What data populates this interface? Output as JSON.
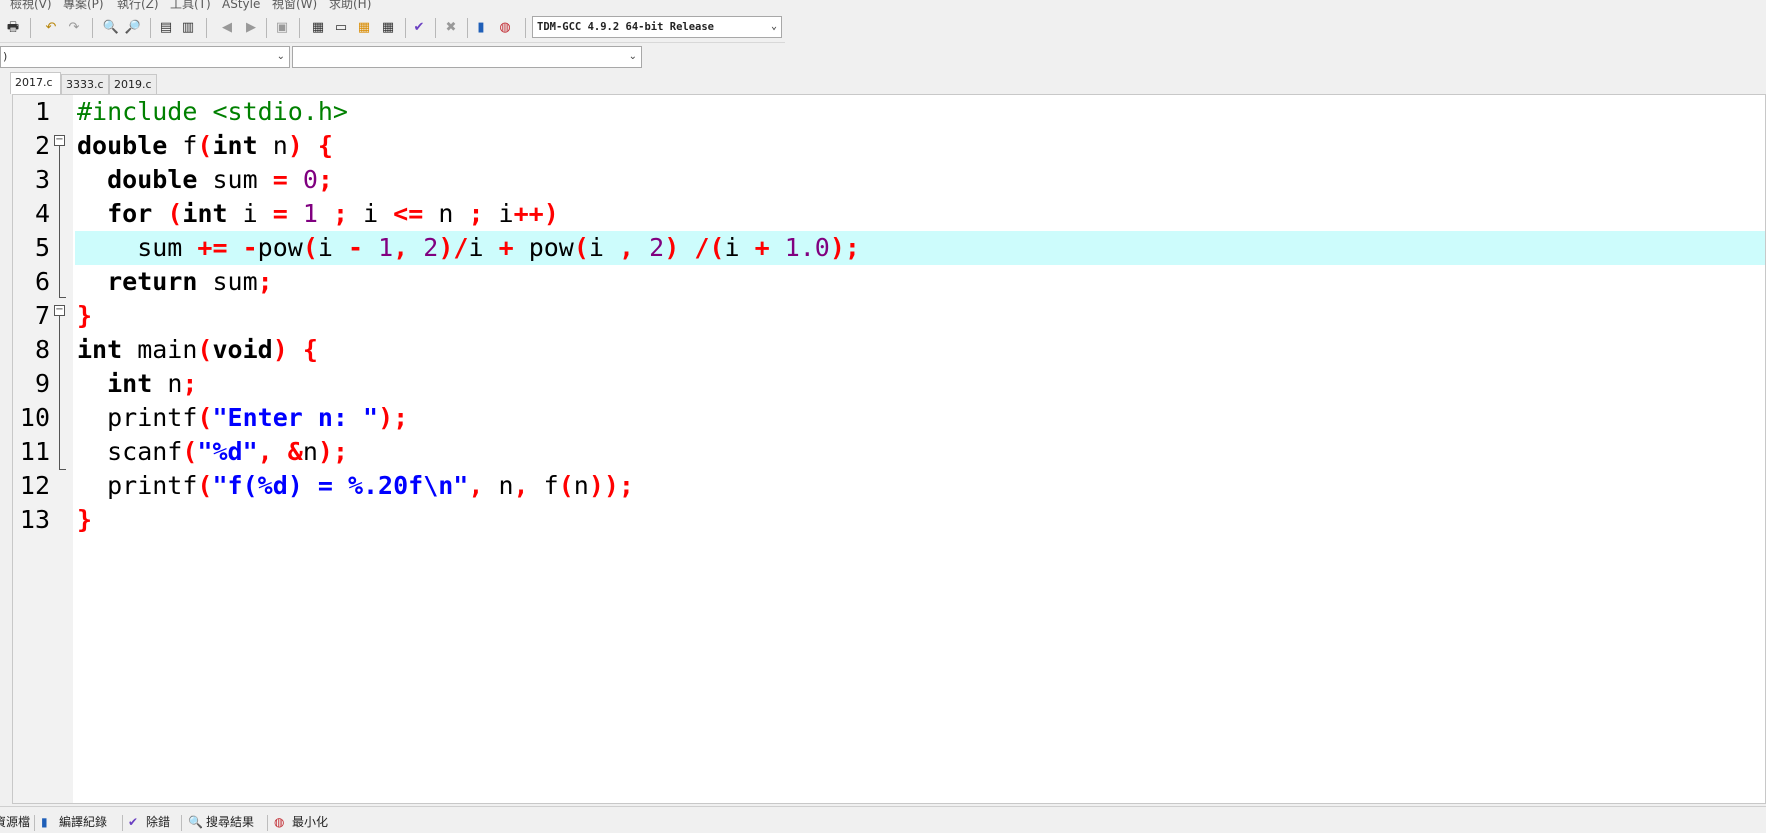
{
  "menu": [
    "檢視(V)",
    "專案(P)",
    "執行(Z)",
    "工具(T)",
    "AStyle",
    "視窗(W)",
    "求助(H)"
  ],
  "toolbar": {
    "icons": [
      "print-icon",
      "undo-icon",
      "redo-icon",
      "find-icon",
      "replace-icon",
      "indent-icon",
      "unindent-icon",
      "bookmark-back-icon",
      "bookmark-forward-icon",
      "goto-icon",
      "new-project-icon",
      "open-project-icon",
      "project-options-icon",
      "class-browser-icon",
      "check-icon",
      "close-icon",
      "chart-icon",
      "profile-icon"
    ],
    "compiler": "TDM-GCC 4.9.2 64-bit Release"
  },
  "scope": {
    "left": ")",
    "right": ""
  },
  "tabs": [
    "2017.c",
    "3333.c",
    "2019.c"
  ],
  "active_tab": "2017.c",
  "highlight_color": "#cdfcfc",
  "code": [
    {
      "n": "1",
      "tokens": [
        [
          "pre",
          "#include <stdio.h>"
        ]
      ]
    },
    {
      "n": "2",
      "tokens": [
        [
          "kw",
          "double"
        ],
        [
          "id",
          " f"
        ],
        [
          "sym",
          "("
        ],
        [
          "kw",
          "int"
        ],
        [
          "id",
          " n"
        ],
        [
          "sym",
          ")"
        ],
        [
          "id",
          " "
        ],
        [
          "sym",
          "{"
        ]
      ]
    },
    {
      "n": "3",
      "tokens": [
        [
          "id",
          "  "
        ],
        [
          "kw",
          "double"
        ],
        [
          "id",
          " sum "
        ],
        [
          "sym",
          "="
        ],
        [
          "id",
          " "
        ],
        [
          "num",
          "0"
        ],
        [
          "sym",
          ";"
        ]
      ]
    },
    {
      "n": "4",
      "tokens": [
        [
          "id",
          "  "
        ],
        [
          "kw",
          "for"
        ],
        [
          "id",
          " "
        ],
        [
          "sym",
          "("
        ],
        [
          "kw",
          "int"
        ],
        [
          "id",
          " i "
        ],
        [
          "sym",
          "="
        ],
        [
          "id",
          " "
        ],
        [
          "num",
          "1"
        ],
        [
          "id",
          " "
        ],
        [
          "sym",
          ";"
        ],
        [
          "id",
          " i "
        ],
        [
          "sym",
          "<="
        ],
        [
          "id",
          " n "
        ],
        [
          "sym",
          ";"
        ],
        [
          "id",
          " i"
        ],
        [
          "sym",
          "++)"
        ]
      ]
    },
    {
      "n": "5",
      "tokens": [
        [
          "id",
          "    sum "
        ],
        [
          "sym",
          "+="
        ],
        [
          "id",
          " "
        ],
        [
          "sym",
          "-"
        ],
        [
          "id",
          "pow"
        ],
        [
          "sym",
          "("
        ],
        [
          "id",
          "i "
        ],
        [
          "sym",
          "-"
        ],
        [
          "id",
          " "
        ],
        [
          "num",
          "1"
        ],
        [
          "sym",
          ","
        ],
        [
          "id",
          " "
        ],
        [
          "num",
          "2"
        ],
        [
          "sym",
          ")/"
        ],
        [
          "id",
          "i "
        ],
        [
          "sym",
          "+"
        ],
        [
          "id",
          " pow"
        ],
        [
          "sym",
          "("
        ],
        [
          "id",
          "i "
        ],
        [
          "sym",
          ","
        ],
        [
          "id",
          " "
        ],
        [
          "num",
          "2"
        ],
        [
          "sym",
          ")"
        ],
        [
          "id",
          " "
        ],
        [
          "sym",
          "/("
        ],
        [
          "id",
          "i "
        ],
        [
          "sym",
          "+"
        ],
        [
          "id",
          " "
        ],
        [
          "num",
          "1.0"
        ],
        [
          "sym",
          ");"
        ]
      ]
    },
    {
      "n": "6",
      "tokens": [
        [
          "id",
          "  "
        ],
        [
          "kw",
          "return"
        ],
        [
          "id",
          " sum"
        ],
        [
          "sym",
          ";"
        ]
      ]
    },
    {
      "n": "7",
      "tokens": [
        [
          "sym",
          "}"
        ]
      ]
    },
    {
      "n": "8",
      "tokens": [
        [
          "kw",
          "int"
        ],
        [
          "id",
          " main"
        ],
        [
          "sym",
          "("
        ],
        [
          "kw",
          "void"
        ],
        [
          "sym",
          ")"
        ],
        [
          "id",
          " "
        ],
        [
          "sym",
          "{"
        ]
      ]
    },
    {
      "n": "9",
      "tokens": [
        [
          "id",
          "  "
        ],
        [
          "kw",
          "int"
        ],
        [
          "id",
          " n"
        ],
        [
          "sym",
          ";"
        ]
      ]
    },
    {
      "n": "10",
      "tokens": [
        [
          "id",
          "  printf"
        ],
        [
          "sym",
          "("
        ],
        [
          "str",
          "\"Enter n: \""
        ],
        [
          "sym",
          ");"
        ]
      ]
    },
    {
      "n": "11",
      "tokens": [
        [
          "id",
          "  scanf"
        ],
        [
          "sym",
          "("
        ],
        [
          "str",
          "\"%d\""
        ],
        [
          "sym",
          ","
        ],
        [
          "id",
          " "
        ],
        [
          "sym",
          "&"
        ],
        [
          "id",
          "n"
        ],
        [
          "sym",
          ");"
        ]
      ]
    },
    {
      "n": "12",
      "tokens": [
        [
          "id",
          "  printf"
        ],
        [
          "sym",
          "("
        ],
        [
          "str",
          "\"f(%d) = %.20f\\n\""
        ],
        [
          "sym",
          ","
        ],
        [
          "id",
          " n"
        ],
        [
          "sym",
          ","
        ],
        [
          "id",
          " f"
        ],
        [
          "sym",
          "("
        ],
        [
          "id",
          "n"
        ],
        [
          "sym",
          "));"
        ]
      ]
    },
    {
      "n": "13",
      "tokens": [
        [
          "sym",
          "}"
        ]
      ]
    }
  ],
  "bottom_tabs": [
    {
      "icon": "source-icon",
      "label": "資源檔"
    },
    {
      "icon": "chart-icon",
      "label": "編譯紀錄"
    },
    {
      "icon": "check-icon",
      "label": "除錯"
    },
    {
      "icon": "find-icon",
      "label": "搜尋結果"
    },
    {
      "icon": "minimize-icon",
      "label": "最小化"
    }
  ]
}
